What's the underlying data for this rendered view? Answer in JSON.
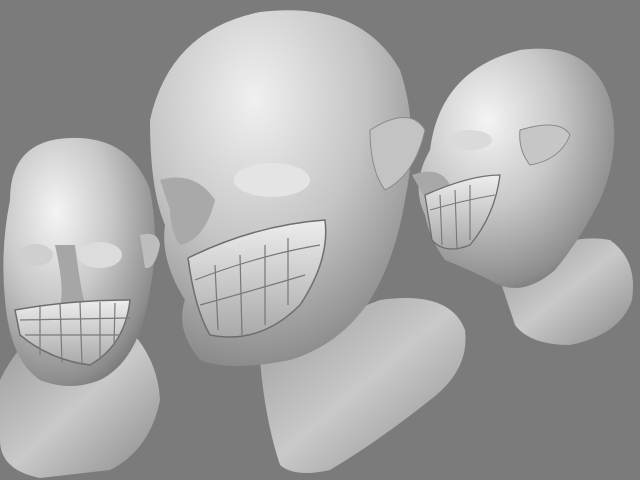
{
  "scene": {
    "background_color": "#7b7b7b",
    "material_highlight": "#f2f2f2",
    "material_base": "#bdbdbd",
    "material_shadow": "#5a5a5a",
    "sculpts": [
      {
        "name": "sculpt-front-view"
      },
      {
        "name": "sculpt-three-quarter-view"
      },
      {
        "name": "sculpt-side-view"
      }
    ]
  }
}
